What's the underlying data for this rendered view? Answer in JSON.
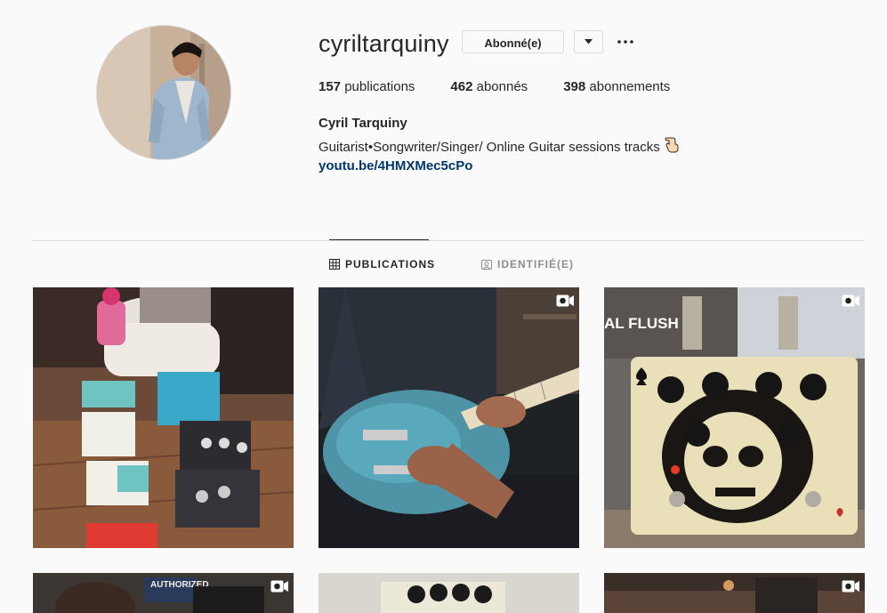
{
  "profile": {
    "username": "cyriltarquiny",
    "follow_label": "Abonné(e)",
    "stats": {
      "posts_count": "157",
      "posts_label": "publications",
      "followers_count": "462",
      "followers_label": "abonnés",
      "following_count": "398",
      "following_label": "abonnements"
    },
    "full_name": "Cyril Tarquiny",
    "bio": "Guitarist•Songwriter/Singer/ Online Guitar sessions tracks",
    "link": "youtu.be/4HMXMec5cPo"
  },
  "tabs": [
    {
      "label": "PUBLICATIONS",
      "icon": "grid-icon",
      "active": true
    },
    {
      "label": "IDENTIFIÉ(E)",
      "icon": "tagged-icon",
      "active": false
    }
  ],
  "posts": [
    {
      "subject": "child with pedalboard",
      "video": false
    },
    {
      "subject": "blue electric guitar",
      "video": true
    },
    {
      "subject": "skull pedal",
      "video": true,
      "overlay_text": "AL FLUSH"
    },
    {
      "subject": "man in shop",
      "video": true,
      "overlay_text": "AUTHORIZED"
    },
    {
      "subject": "pedal",
      "video": false
    },
    {
      "subject": "amp",
      "video": true
    }
  ],
  "colors": {
    "text": "#262626",
    "muted": "#8e8e8e",
    "link": "#00376b",
    "border": "#dbdbdb",
    "background": "#fafafa"
  }
}
